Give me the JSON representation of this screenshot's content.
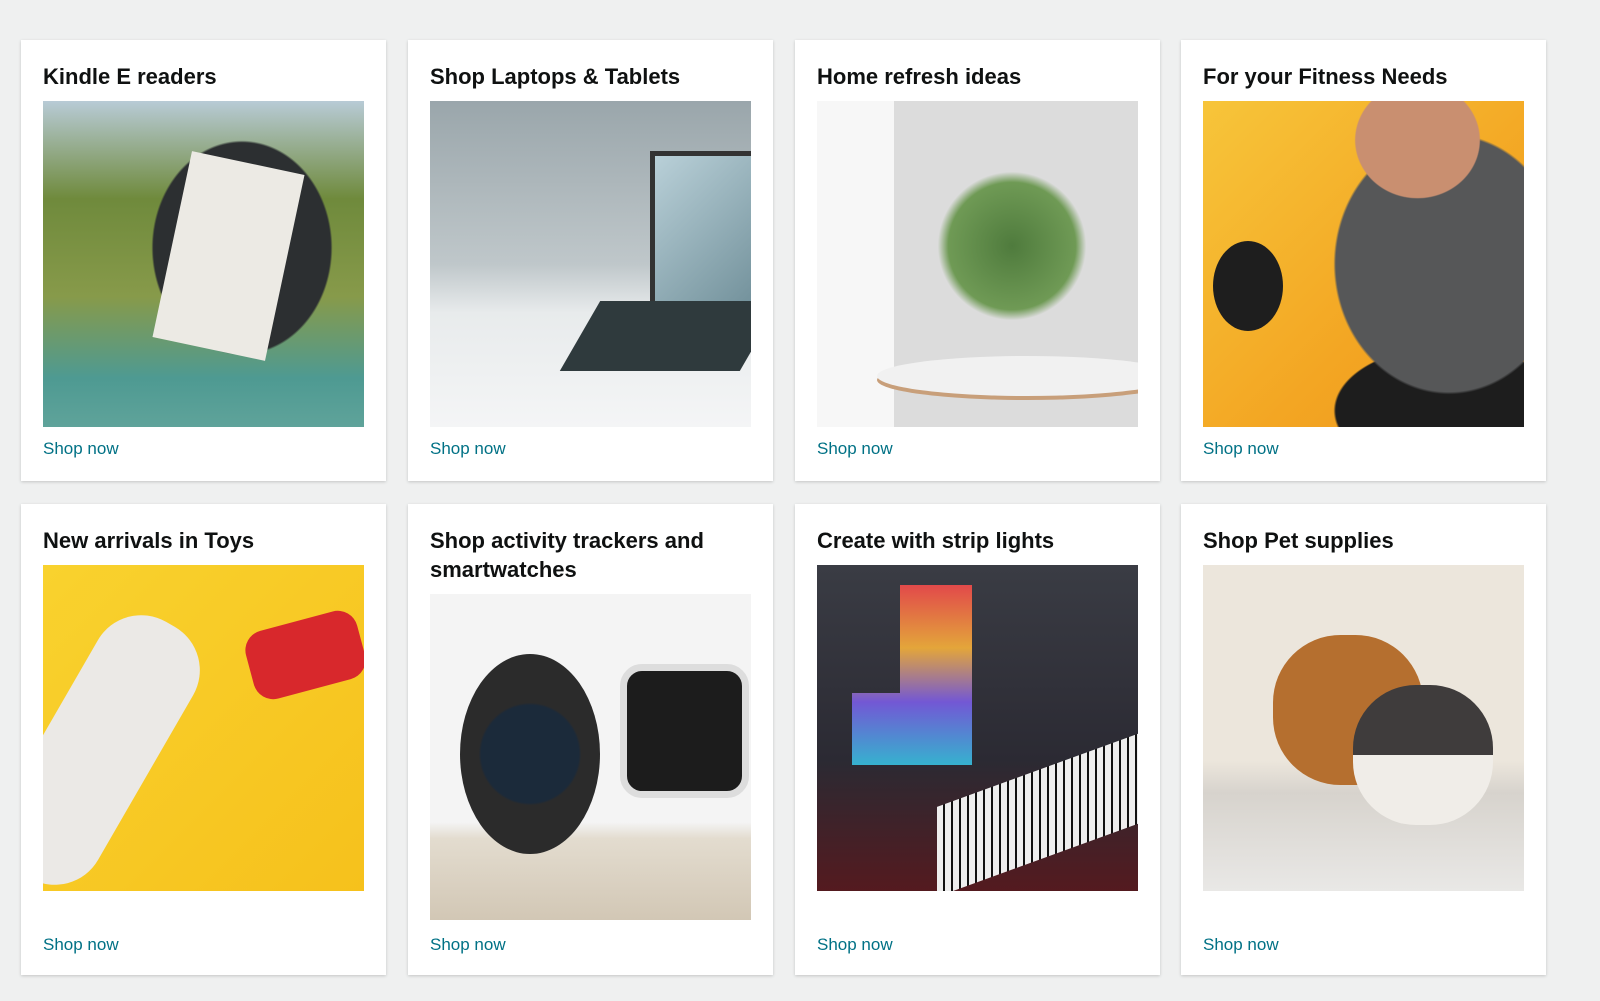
{
  "cards": [
    {
      "title": "Kindle E readers",
      "link": "Shop now"
    },
    {
      "title": "Shop Laptops & Tablets",
      "link": "Shop now"
    },
    {
      "title": "Home refresh ideas",
      "link": "Shop now"
    },
    {
      "title": "For your Fitness Needs",
      "link": "Shop now"
    },
    {
      "title": "New arrivals in Toys",
      "link": "Shop now"
    },
    {
      "title": "Shop activity trackers and smartwatches",
      "link": "Shop now"
    },
    {
      "title": "Create with strip lights",
      "link": "Shop now"
    },
    {
      "title": "Shop Pet supplies",
      "link": "Shop now"
    }
  ],
  "colors": {
    "link": "#007185",
    "background": "#eff0f0",
    "title": "#0f1111"
  }
}
